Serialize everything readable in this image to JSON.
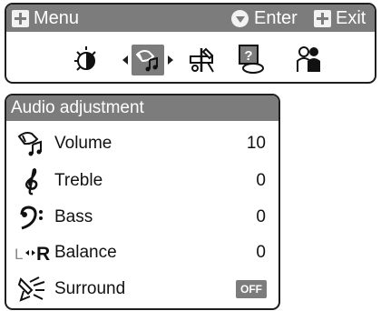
{
  "menu": {
    "title": "Menu",
    "enter_label": "Enter",
    "exit_label": "Exit",
    "icons": [
      "contrast-icon",
      "audio-icon",
      "settings-icon",
      "help-icon",
      "people-icon"
    ],
    "selected_icon": "audio-icon"
  },
  "audio": {
    "title": "Audio adjustment",
    "rows": [
      {
        "label": "Volume",
        "value": "10",
        "icon": "volume-icon"
      },
      {
        "label": "Treble",
        "value": "0",
        "icon": "treble-clef-icon"
      },
      {
        "label": "Bass",
        "value": "0",
        "icon": "bass-clef-icon"
      },
      {
        "label": "Balance",
        "value": "0",
        "icon": "balance-icon"
      },
      {
        "label": "Surround",
        "value": "OFF",
        "icon": "surround-icon"
      }
    ],
    "balance_icon_left": "L",
    "balance_icon_right": "R"
  },
  "colors": {
    "bar": "#7c7c7c",
    "border": "#1e1e1e"
  }
}
